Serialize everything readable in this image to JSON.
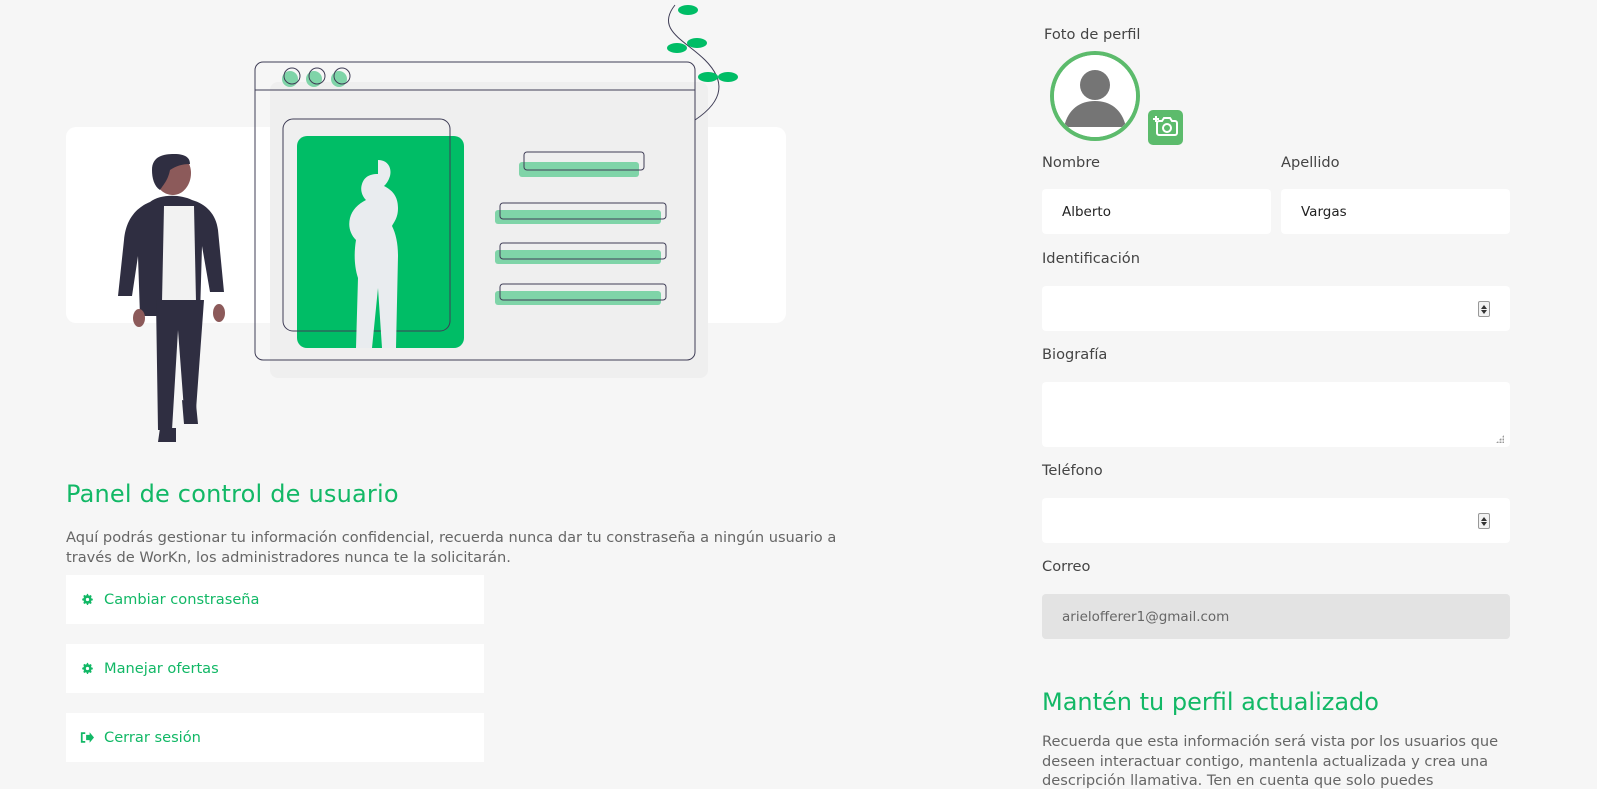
{
  "panel": {
    "title": "Panel de control de usuario",
    "description": "Aquí podrás gestionar tu información confidencial, recuerda nunca dar tu constraseña a ningún usuario a través de WorKn, los administradores nunca te la solicitarán.",
    "actions": [
      {
        "label": "Cambiar constraseña",
        "icon": "gear-icon"
      },
      {
        "label": "Manejar ofertas",
        "icon": "gear-icon"
      },
      {
        "label": "Cerrar sesión",
        "icon": "sign-out-icon"
      }
    ]
  },
  "profile": {
    "photo_label": "Foto de perfil",
    "first_name_label": "Nombre",
    "first_name_value": "Alberto",
    "last_name_label": "Apellido",
    "last_name_value": "Vargas",
    "id_label": "Identificación",
    "id_value": "",
    "bio_label": "Biografía",
    "bio_value": "",
    "phone_label": "Teléfono",
    "phone_value": "",
    "email_label": "Correo",
    "email_value": "arielofferer1@gmail.com"
  },
  "update": {
    "title": "Mantén tu perfil actualizado",
    "description": "Recuerda que esta información será vista por los usuarios que deseen interactuar contigo, mantenla actualizada y crea una descripción llamativa. Ten en cuenta que solo puedes"
  },
  "colors": {
    "accent": "#12b866",
    "avatar_ring": "#5cbb6c",
    "background": "#f6f6f6"
  }
}
